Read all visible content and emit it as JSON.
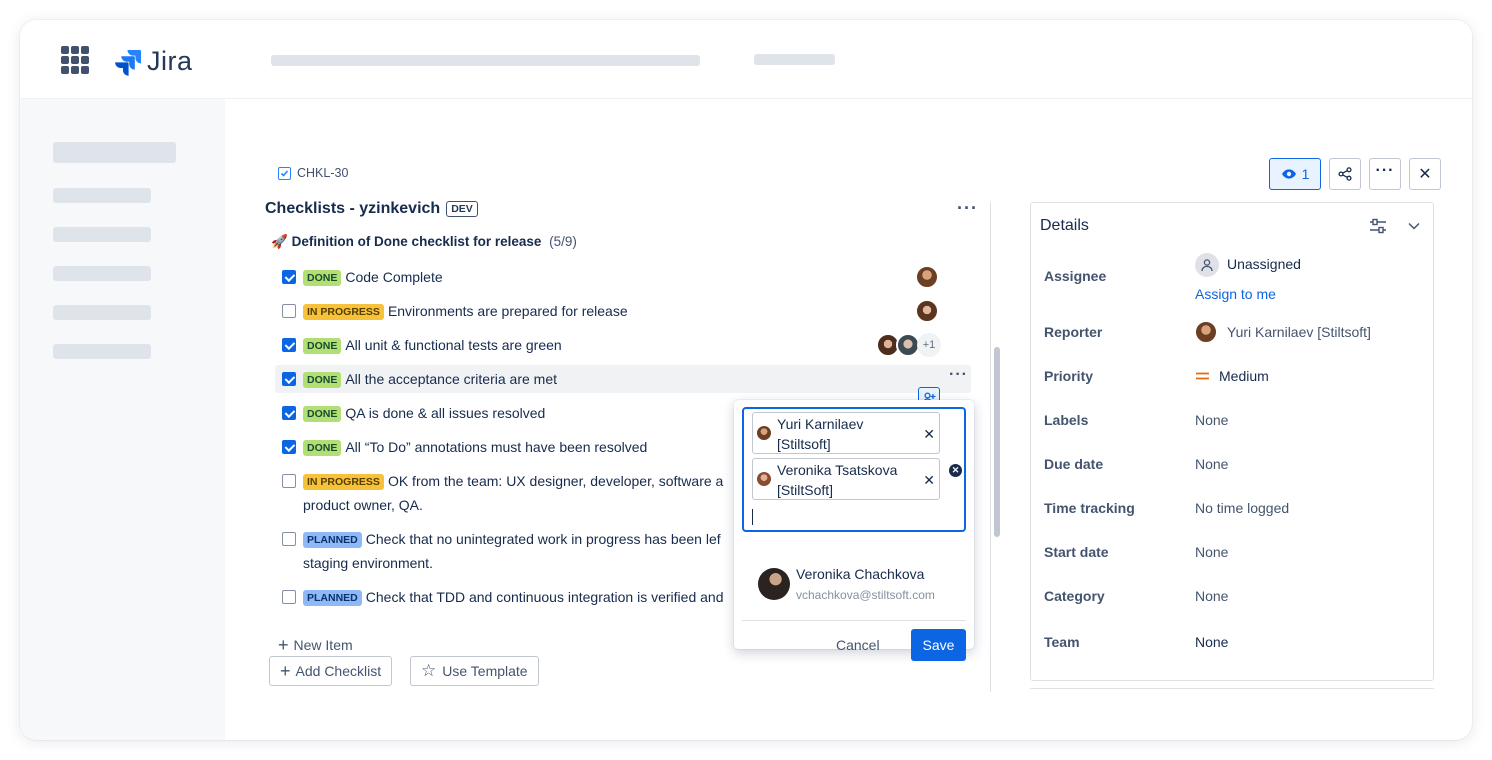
{
  "app": {
    "name": "Jira"
  },
  "issue": {
    "key": "CHKL-30"
  },
  "checklist": {
    "title": "Checklists - yzinkevich",
    "env_badge": "DEV",
    "subtitle_emoji": "🚀",
    "subtitle": "Definition of Done checklist for release",
    "progress": "(5/9)",
    "items": [
      {
        "checked": true,
        "status": "DONE",
        "text": "Code Complete"
      },
      {
        "checked": false,
        "status": "IN PROGRESS",
        "text": "Environments are prepared for release"
      },
      {
        "checked": true,
        "status": "DONE",
        "text": "All unit & functional tests are green"
      },
      {
        "checked": true,
        "status": "DONE",
        "text": "All the acceptance criteria are met"
      },
      {
        "checked": true,
        "status": "DONE",
        "text": "QA is done & all issues resolved"
      },
      {
        "checked": true,
        "status": "DONE",
        "text": "All “To Do” annotations must have been resolved"
      },
      {
        "checked": false,
        "status": "IN PROGRESS",
        "text": "OK from the team: UX designer, developer, software a",
        "text2": "product owner, QA."
      },
      {
        "checked": false,
        "status": "PLANNED",
        "text": "Check that no unintegrated work in progress has been lef",
        "text2": "staging environment."
      },
      {
        "checked": false,
        "status": "PLANNED",
        "text": "Check that TDD and continuous integration is verified and"
      }
    ],
    "extra_assignees": "+1",
    "new_item_label": "New Item",
    "add_checklist_label": "Add Checklist",
    "use_template_label": "Use Template"
  },
  "assign_popup": {
    "selected": [
      {
        "name_line1": "Yuri Karnilaev",
        "name_line2": "[Stiltsoft]"
      },
      {
        "name_line1": "Veronika Tsatskova",
        "name_line2": "[StiltSoft]"
      }
    ],
    "suggestion": {
      "name": "Veronika Chachkova",
      "email": "vchachkova@stiltsoft.com"
    },
    "cancel_label": "Cancel",
    "save_label": "Save"
  },
  "toolbar": {
    "watch_count": "1"
  },
  "details": {
    "title": "Details",
    "assignee_label": "Assignee",
    "assignee_value": "Unassigned",
    "assign_to_me": "Assign to me",
    "reporter_label": "Reporter",
    "reporter_value": "Yuri Karnilaev [Stiltsoft]",
    "priority_label": "Priority",
    "priority_value": "Medium",
    "labels_label": "Labels",
    "labels_value": "None",
    "due_label": "Due date",
    "due_value": "None",
    "time_label": "Time tracking",
    "time_value": "No time logged",
    "start_label": "Start date",
    "start_value": "None",
    "category_label": "Category",
    "category_value": "None",
    "team_label": "Team",
    "team_value": "None"
  },
  "colors": {
    "accent": "#0c66e4",
    "done": "#b3df72",
    "in_progress": "#f8c13a",
    "planned": "#8fb8f6",
    "priority_medium": "#e56910"
  }
}
